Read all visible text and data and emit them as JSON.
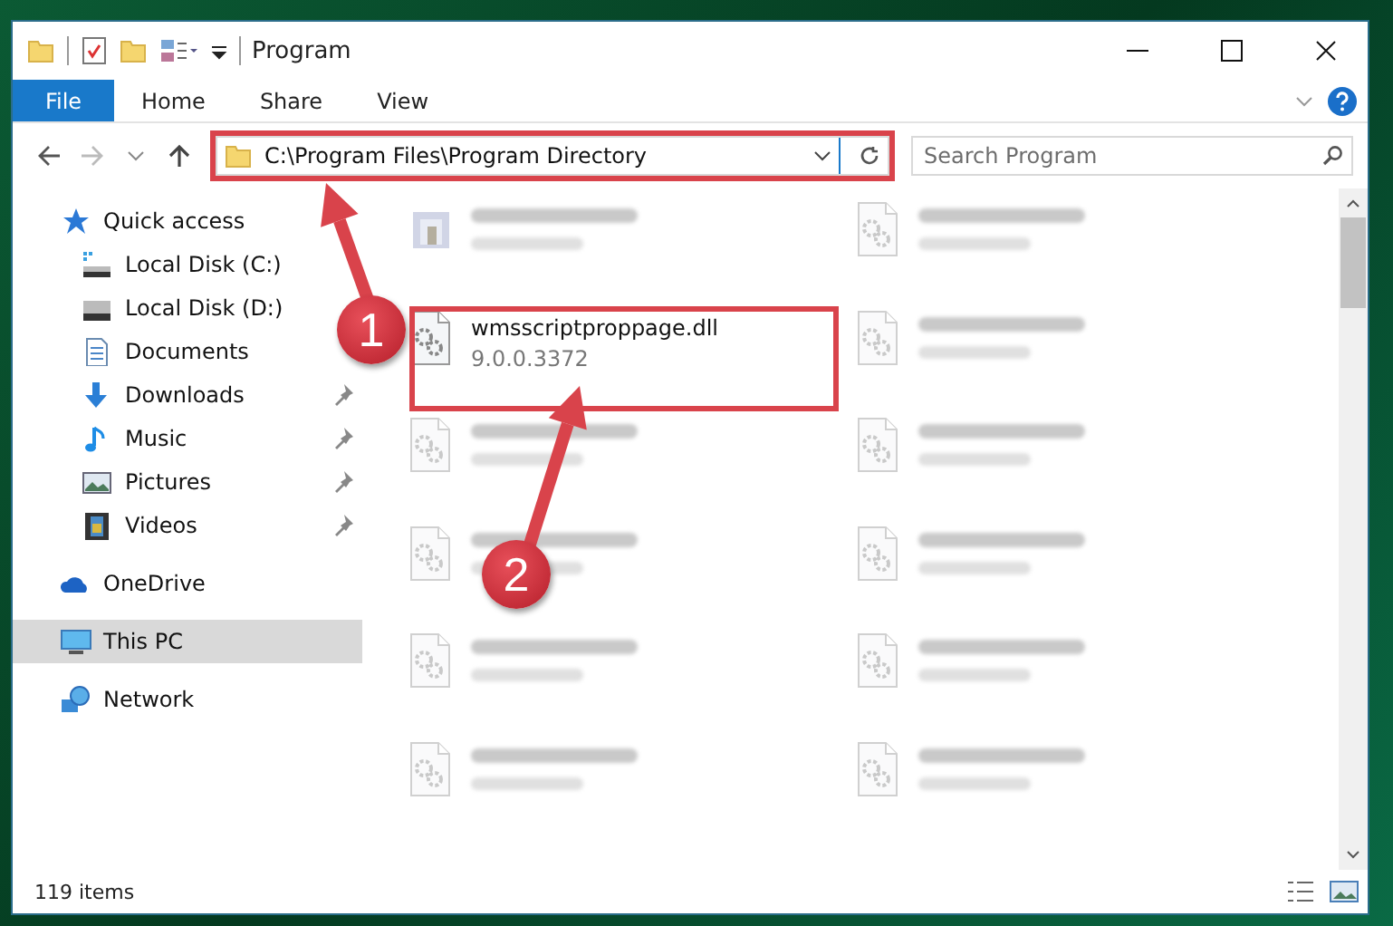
{
  "window": {
    "title": "Program"
  },
  "ribbon": {
    "tabs": [
      {
        "label": "File",
        "selected": true
      },
      {
        "label": "Home",
        "selected": false
      },
      {
        "label": "Share",
        "selected": false
      },
      {
        "label": "View",
        "selected": false
      }
    ]
  },
  "address_bar": {
    "path": "C:\\Program Files\\Program Directory"
  },
  "search": {
    "placeholder": "Search Program"
  },
  "nav_pane": {
    "items": [
      {
        "label": "Quick access",
        "kind": "star",
        "selected": false,
        "children": [
          {
            "label": "Local Disk (C:)",
            "kind": "disk-c",
            "pinned": false,
            "selected": false
          },
          {
            "label": "Local Disk (D:)",
            "kind": "disk",
            "pinned": false,
            "selected": false
          },
          {
            "label": "Documents",
            "kind": "document",
            "pinned": false,
            "selected": false
          },
          {
            "label": "Downloads",
            "kind": "download",
            "pinned": true,
            "selected": false
          },
          {
            "label": "Music",
            "kind": "music",
            "pinned": true,
            "selected": false
          },
          {
            "label": "Pictures",
            "kind": "picture",
            "pinned": true,
            "selected": false
          },
          {
            "label": "Videos",
            "kind": "video",
            "pinned": true,
            "selected": false
          }
        ]
      },
      {
        "label": "OneDrive",
        "kind": "cloud",
        "selected": false
      },
      {
        "label": "This PC",
        "kind": "pc",
        "selected": true
      },
      {
        "label": "Network",
        "kind": "network",
        "selected": false
      }
    ]
  },
  "files": [
    {
      "kind": "exe",
      "blurred": true
    },
    {
      "kind": "dll",
      "blurred": true
    },
    {
      "name": "wmsscriptproppage.dll",
      "detail": "9.0.0.3372",
      "kind": "dll",
      "blurred": false
    },
    {
      "kind": "dll",
      "blurred": true
    },
    {
      "kind": "dll",
      "blurred": true
    },
    {
      "kind": "dll",
      "blurred": true
    },
    {
      "kind": "dll",
      "blurred": true
    },
    {
      "kind": "dll",
      "blurred": true
    },
    {
      "kind": "dll",
      "blurred": true
    },
    {
      "kind": "dll",
      "blurred": true
    },
    {
      "kind": "dll",
      "blurred": true
    },
    {
      "kind": "dll",
      "blurred": true
    }
  ],
  "status_bar": {
    "item_count": "119 items"
  },
  "annotations": {
    "callouts": [
      {
        "label": "1"
      },
      {
        "label": "2"
      }
    ]
  }
}
